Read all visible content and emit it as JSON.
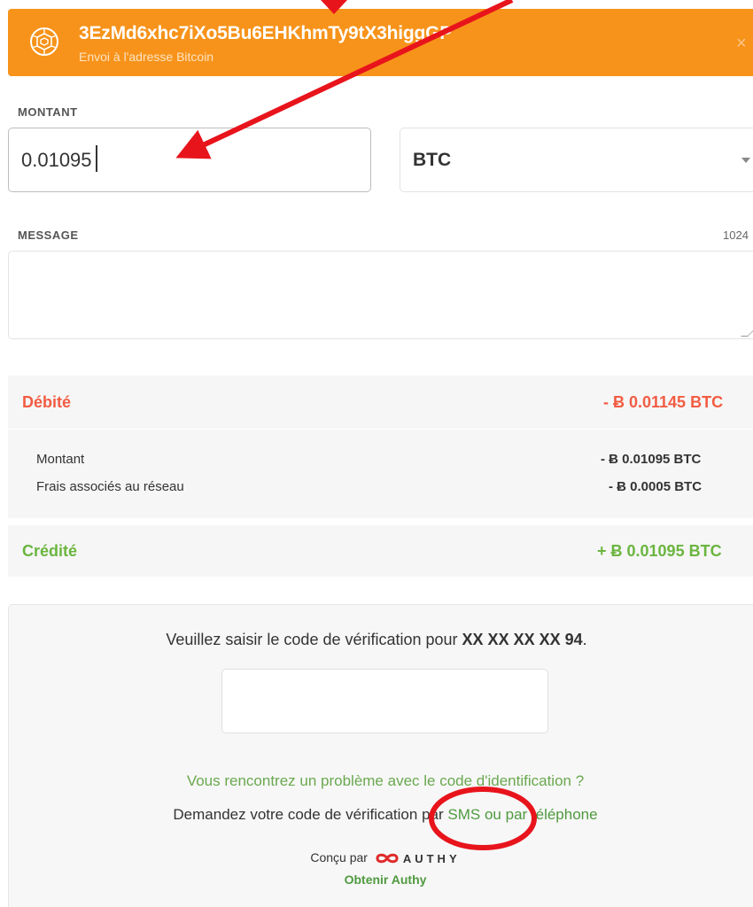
{
  "banner": {
    "address": "3EzMd6xhc7iXo5Bu6EHKhmTy9tX3higgGP",
    "subtitle": "Envoi à l'adresse Bitcoin",
    "close": "×",
    "icon": "bitcoin-coin-icon"
  },
  "amount": {
    "label": "MONTANT",
    "value": "0.01095",
    "currency": "BTC",
    "currency_icon": "chevron-down-icon"
  },
  "message": {
    "label": "MESSAGE",
    "counter": "1024",
    "value": ""
  },
  "summary": {
    "debit_label": "Débité",
    "debit_amount": "- Ƀ 0.01145 BTC",
    "amount_label": "Montant",
    "amount_value": "- Ƀ 0.01095 BTC",
    "fee_label": "Frais associés au réseau",
    "fee_value": "- Ƀ 0.0005 BTC",
    "credit_label": "Crédité",
    "credit_amount": "+ Ƀ 0.01095 BTC"
  },
  "verification": {
    "prompt": "Veuillez saisir le code de vérification pour ",
    "phone": "XX XX XX XX 94",
    "period": ".",
    "code_value": "",
    "trouble_link": "Vous rencontrez un problème avec le code d'identification ?",
    "request_prefix": "Demandez votre code de vérification ",
    "request_par": "par",
    "sms_link": "SMS",
    "or": "ou",
    "phone_link": "par téléphone",
    "designed_by": "Conçu par",
    "authy_brand": "AUTHY",
    "get_authy": "Obtenir Authy"
  },
  "colors": {
    "banner": "#f7931a",
    "debit": "#f25c43",
    "credit": "#6ab53f",
    "link": "#4f9a3f",
    "annotation": "#e8141c"
  }
}
